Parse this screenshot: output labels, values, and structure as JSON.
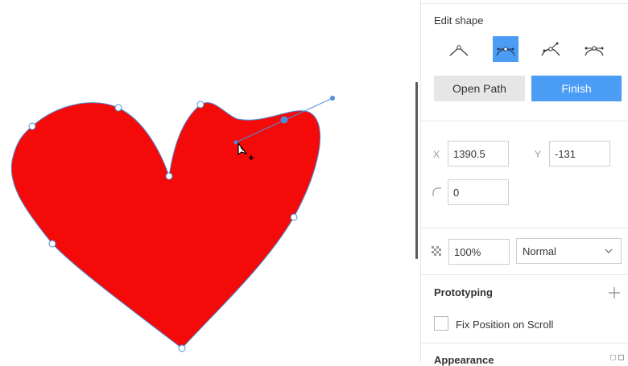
{
  "panel": {
    "edit_shape_title": "Edit shape",
    "modes": [
      {
        "icon": "straight-point-icon",
        "active": false
      },
      {
        "icon": "mirrored-point-icon",
        "active": true
      },
      {
        "icon": "disconnected-point-icon",
        "active": false
      },
      {
        "icon": "asymmetric-point-icon",
        "active": false
      }
    ],
    "open_path_label": "Open Path",
    "finish_label": "Finish",
    "x_label": "X",
    "x_value": "1390.5",
    "y_label": "Y",
    "y_value": "-131",
    "corner_radius_value": "0",
    "opacity_value": "100%",
    "blend_mode": "Normal",
    "prototyping_title": "Prototyping",
    "fix_position_label": "Fix Position on Scroll",
    "fix_position_checked": false,
    "appearance_title": "Appearance"
  },
  "canvas": {
    "shape": "heart",
    "fill_color": "#f50a0a",
    "outline_color": "#4a8fd8"
  }
}
